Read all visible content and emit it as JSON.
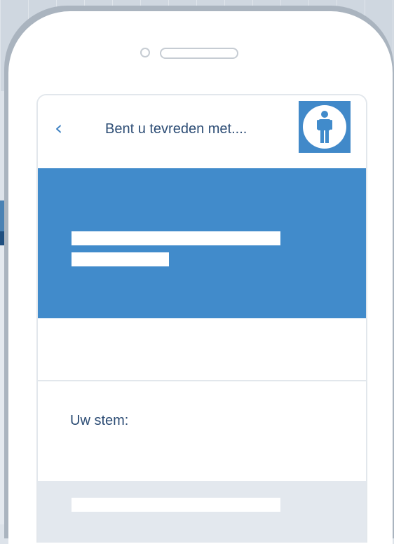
{
  "header": {
    "back_icon": "chevron-left-icon",
    "back_glyph": "‹",
    "title": "Bent u tevreden met....",
    "avatar_icon": "person-icon"
  },
  "vote": {
    "label": "Uw stem:"
  },
  "colors": {
    "accent": "#418bcb",
    "title_text": "#2d4d75",
    "back_chevron": "#3c80c2",
    "footer_band": "#e3e8ee"
  }
}
